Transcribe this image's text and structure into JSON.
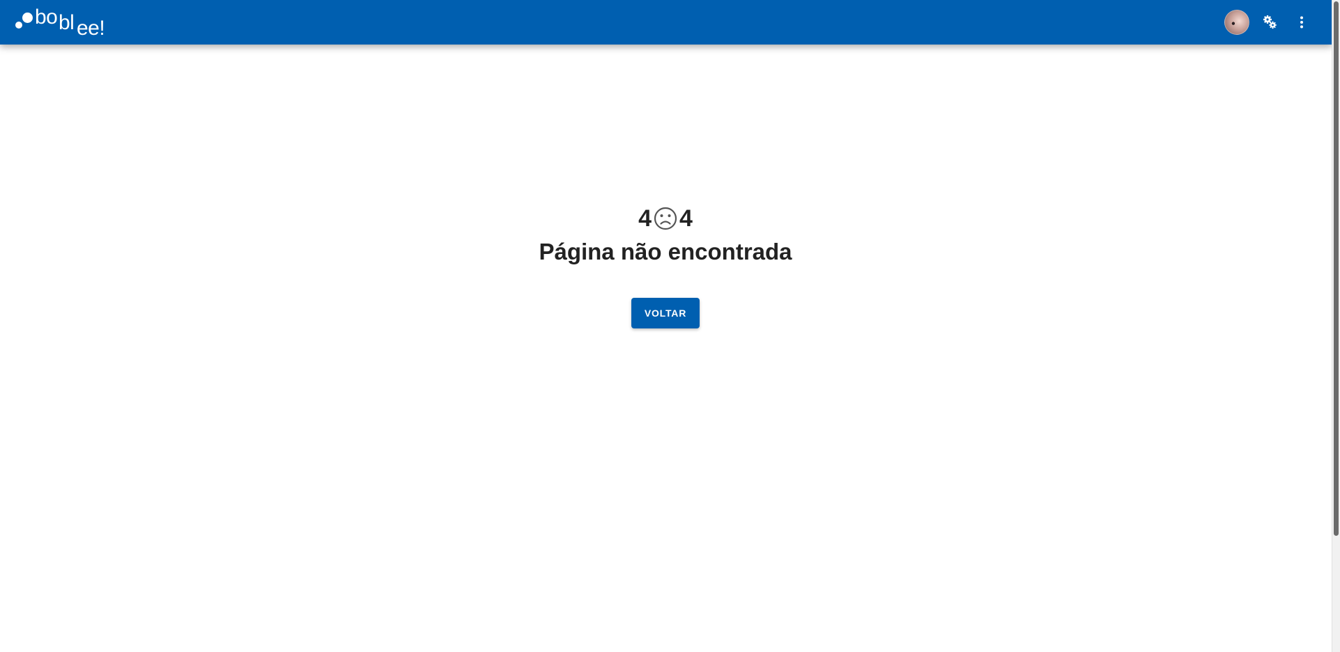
{
  "brand": {
    "logo_parts": [
      "bo",
      "bl",
      "ee!"
    ],
    "color": "#005fb0"
  },
  "header": {
    "avatar_icon": "user-avatar",
    "settings_icon": "gears-icon",
    "menu_icon": "more-vertical-icon"
  },
  "error": {
    "code_left": "4",
    "code_icon": "sad-face-icon",
    "code_right": "4",
    "title": "Página não encontrada",
    "back_label": "VOLTAR"
  }
}
